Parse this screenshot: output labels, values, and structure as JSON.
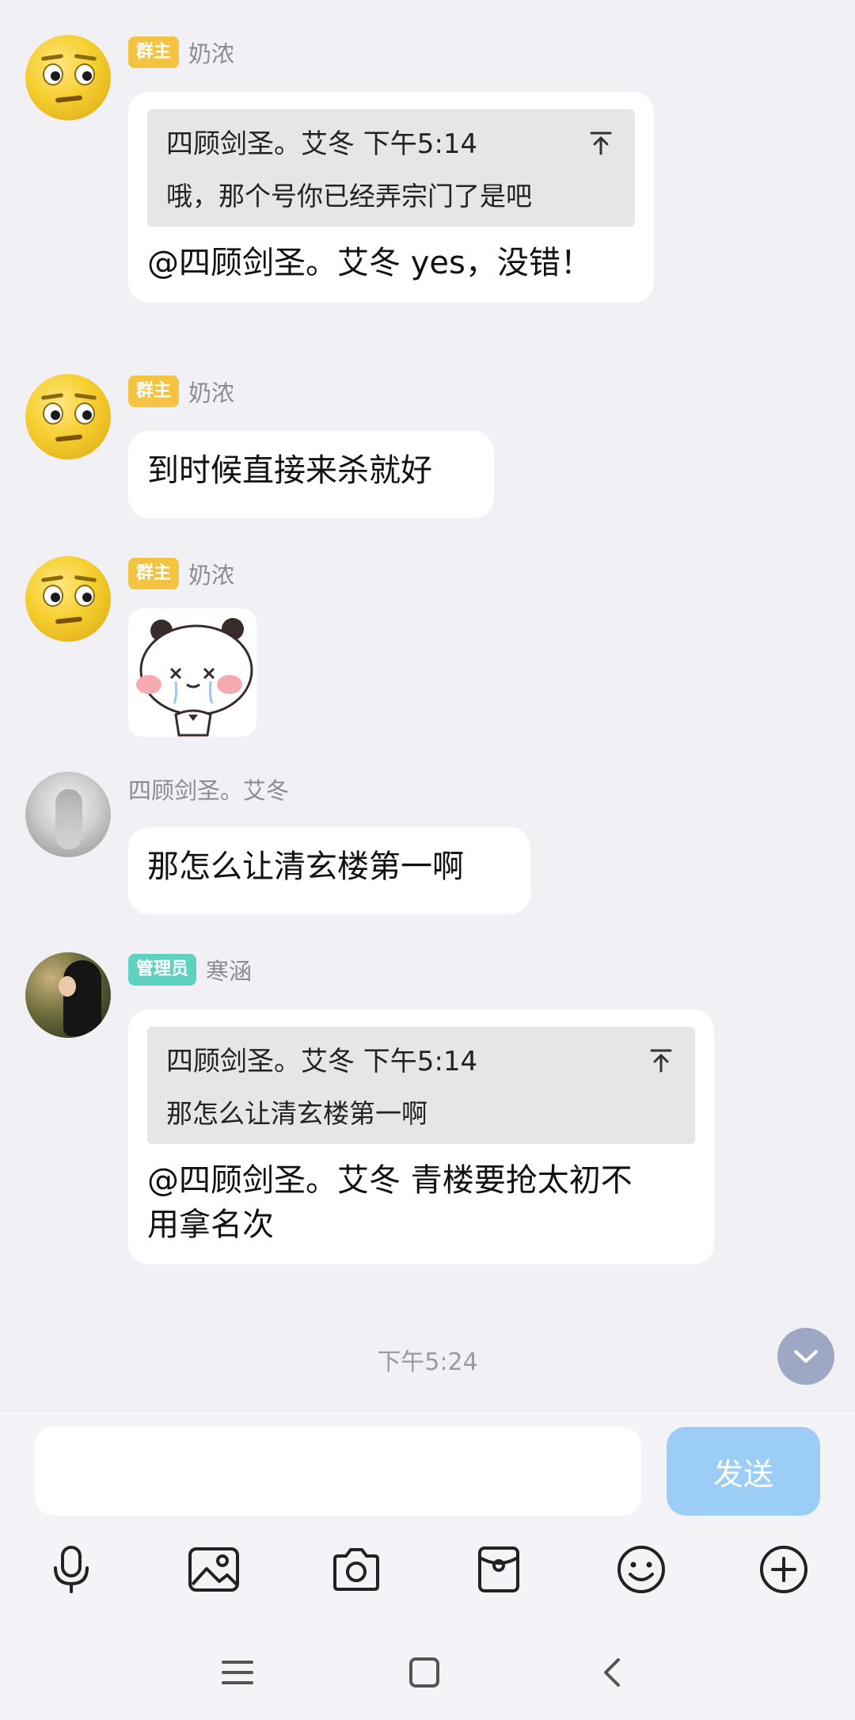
{
  "messages": [
    {
      "badge": "群主",
      "sender": "奶浓",
      "quote": {
        "header": "四顾剑圣。艾冬 下午5:14",
        "body": "哦，那个号你已经弄宗门了是吧"
      },
      "text": "@四顾剑圣。艾冬 yes，没错！"
    },
    {
      "badge": "群主",
      "sender": "奶浓",
      "text": "到时候直接来杀就好"
    },
    {
      "badge": "群主",
      "sender": "奶浓",
      "sticker": "panda-crying-sticker"
    },
    {
      "sender": "四顾剑圣。艾冬",
      "text": "那怎么让清玄楼第一啊"
    },
    {
      "badge": "管理员",
      "sender": "寒涵",
      "quote": {
        "header": "四顾剑圣。艾冬 下午5:14",
        "body": "那怎么让清玄楼第一啊"
      },
      "text_lines": [
        "@四顾剑圣。艾冬 青楼要抢太初不",
        "用拿名次"
      ]
    }
  ],
  "timestamp": "下午5:24",
  "input": {
    "value": "",
    "send_label": "发送"
  },
  "toolbar": [
    "microphone-icon",
    "image-icon",
    "camera-icon",
    "red-packet-icon",
    "emoji-icon",
    "plus-icon"
  ],
  "navbar": [
    "menu-icon",
    "home-icon",
    "back-icon"
  ],
  "colors": {
    "background": "#f1f1f5",
    "owner_badge": "#f5c342",
    "admin_badge": "#5fd1c0",
    "send_button": "#9ccdf6",
    "scroll_button": "#9ea7c4"
  }
}
